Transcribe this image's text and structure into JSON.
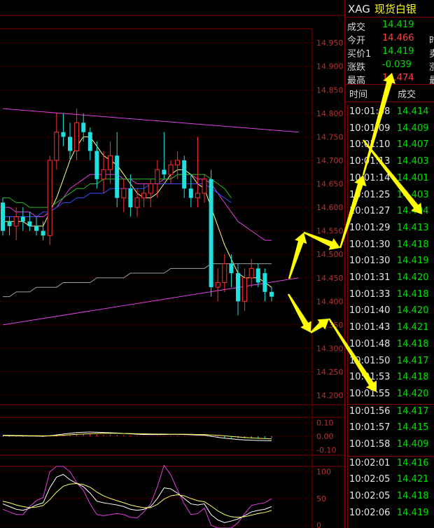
{
  "chart_data": {
    "type": "candlestick",
    "y_axis_ticks": [
      "14.950",
      "14.900",
      "14.850",
      "14.800",
      "14.750",
      "14.700",
      "14.650",
      "14.600",
      "14.550",
      "14.500",
      "14.450",
      "14.400",
      "14.350",
      "14.300",
      "14.250",
      "14.200"
    ],
    "ylim": [
      14.18,
      14.98
    ],
    "candles": [
      {
        "o": 14.61,
        "h": 14.62,
        "l": 14.54,
        "c": 14.55
      },
      {
        "o": 14.57,
        "h": 14.58,
        "l": 14.54,
        "c": 14.56
      },
      {
        "o": 14.56,
        "h": 14.6,
        "l": 14.53,
        "c": 14.58
      },
      {
        "o": 14.58,
        "h": 14.6,
        "l": 14.55,
        "c": 14.57
      },
      {
        "o": 14.57,
        "h": 14.59,
        "l": 14.55,
        "c": 14.56
      },
      {
        "o": 14.56,
        "h": 14.58,
        "l": 14.54,
        "c": 14.55
      },
      {
        "o": 14.55,
        "h": 14.57,
        "l": 14.53,
        "c": 14.54
      },
      {
        "o": 14.54,
        "h": 14.71,
        "l": 14.52,
        "c": 14.7
      },
      {
        "o": 14.7,
        "h": 14.8,
        "l": 14.68,
        "c": 14.76
      },
      {
        "o": 14.76,
        "h": 14.8,
        "l": 14.73,
        "c": 14.75
      },
      {
        "o": 14.75,
        "h": 14.78,
        "l": 14.7,
        "c": 14.72
      },
      {
        "o": 14.72,
        "h": 14.81,
        "l": 14.7,
        "c": 14.78
      },
      {
        "o": 14.78,
        "h": 14.8,
        "l": 14.74,
        "c": 14.76
      },
      {
        "o": 14.76,
        "h": 14.77,
        "l": 14.7,
        "c": 14.72
      },
      {
        "o": 14.72,
        "h": 14.74,
        "l": 14.64,
        "c": 14.66
      },
      {
        "o": 14.66,
        "h": 14.72,
        "l": 14.63,
        "c": 14.68
      },
      {
        "o": 14.68,
        "h": 14.74,
        "l": 14.65,
        "c": 14.71
      },
      {
        "o": 14.71,
        "h": 14.76,
        "l": 14.6,
        "c": 14.62
      },
      {
        "o": 14.62,
        "h": 14.66,
        "l": 14.59,
        "c": 14.64
      },
      {
        "o": 14.64,
        "h": 14.67,
        "l": 14.58,
        "c": 14.6
      },
      {
        "o": 14.6,
        "h": 14.64,
        "l": 14.58,
        "c": 14.62
      },
      {
        "o": 14.62,
        "h": 14.65,
        "l": 14.6,
        "c": 14.63
      },
      {
        "o": 14.63,
        "h": 14.66,
        "l": 14.6,
        "c": 14.65
      },
      {
        "o": 14.65,
        "h": 14.7,
        "l": 14.62,
        "c": 14.68
      },
      {
        "o": 14.68,
        "h": 14.76,
        "l": 14.66,
        "c": 14.67
      },
      {
        "o": 14.67,
        "h": 14.7,
        "l": 14.65,
        "c": 14.69
      },
      {
        "o": 14.69,
        "h": 14.72,
        "l": 14.66,
        "c": 14.7
      },
      {
        "o": 14.7,
        "h": 14.71,
        "l": 14.62,
        "c": 14.64
      },
      {
        "o": 14.64,
        "h": 14.67,
        "l": 14.6,
        "c": 14.62
      },
      {
        "o": 14.62,
        "h": 14.75,
        "l": 14.6,
        "c": 14.63
      },
      {
        "o": 14.63,
        "h": 14.67,
        "l": 14.61,
        "c": 14.66
      },
      {
        "o": 14.66,
        "h": 14.68,
        "l": 14.41,
        "c": 14.43
      },
      {
        "o": 14.43,
        "h": 14.47,
        "l": 14.4,
        "c": 14.44
      },
      {
        "o": 14.44,
        "h": 14.5,
        "l": 14.42,
        "c": 14.48
      },
      {
        "o": 14.48,
        "h": 14.5,
        "l": 14.43,
        "c": 14.46
      },
      {
        "o": 14.46,
        "h": 14.48,
        "l": 14.37,
        "c": 14.4
      },
      {
        "o": 14.4,
        "h": 14.47,
        "l": 14.38,
        "c": 14.45
      },
      {
        "o": 14.45,
        "h": 14.49,
        "l": 14.43,
        "c": 14.47
      },
      {
        "o": 14.47,
        "h": 14.48,
        "l": 14.43,
        "c": 14.44
      },
      {
        "o": 14.46,
        "h": 14.47,
        "l": 14.4,
        "c": 14.42
      },
      {
        "o": 14.42,
        "h": 14.43,
        "l": 14.4,
        "c": 14.41
      }
    ],
    "ma_lines": [
      {
        "color": "#ffff80",
        "values": [
          14.57,
          14.57,
          14.57,
          14.57,
          14.56,
          14.56,
          14.56,
          14.59,
          14.62,
          14.66,
          14.7,
          14.73,
          14.75,
          14.75,
          14.73,
          14.71,
          14.7,
          14.69,
          14.67,
          14.65,
          14.63,
          14.62,
          14.62,
          14.63,
          14.65,
          14.67,
          14.68,
          14.68,
          14.67,
          14.65,
          14.64,
          14.6,
          14.56,
          14.52,
          14.49,
          14.46,
          14.45,
          14.45,
          14.45,
          14.44,
          14.43
        ]
      },
      {
        "color": "#e040e0",
        "values": [
          14.6,
          14.6,
          14.59,
          14.59,
          14.59,
          14.58,
          14.58,
          14.59,
          14.6,
          14.62,
          14.64,
          14.65,
          14.66,
          14.67,
          14.67,
          14.67,
          14.67,
          14.67,
          14.66,
          14.66,
          14.65,
          14.65,
          14.65,
          14.65,
          14.66,
          14.66,
          14.67,
          14.67,
          14.67,
          14.66,
          14.66,
          14.65,
          14.63,
          14.61,
          14.59,
          14.57,
          14.56,
          14.55,
          14.54,
          14.53,
          14.53
        ]
      },
      {
        "color": "#20c020",
        "values": [
          14.62,
          14.62,
          14.61,
          14.61,
          14.6,
          14.6,
          14.6,
          14.6,
          14.61,
          14.62,
          14.63,
          14.64,
          14.64,
          14.65,
          14.65,
          14.66,
          14.66,
          14.66,
          14.66,
          14.66,
          14.66,
          14.66,
          14.66,
          14.66,
          14.66,
          14.66,
          14.67,
          14.67,
          14.67,
          14.67,
          14.67,
          14.66,
          14.65,
          14.64,
          14.62
        ]
      },
      {
        "color": "#3050ff",
        "values": [
          14.58,
          14.58,
          14.58,
          14.58,
          14.58,
          14.58,
          14.59,
          14.59,
          14.6,
          14.61,
          14.61,
          14.62,
          14.62,
          14.63,
          14.63,
          14.63,
          14.64,
          14.64,
          14.64,
          14.64,
          14.64,
          14.64,
          14.65,
          14.65,
          14.65,
          14.65,
          14.65,
          14.65,
          14.65,
          14.65,
          14.65,
          14.64,
          14.63,
          14.62,
          14.61
        ]
      },
      {
        "color": "#a0a0a0",
        "values": [
          14.41,
          14.41,
          14.42,
          14.42,
          14.42,
          14.43,
          14.43,
          14.43,
          14.43,
          14.44,
          14.44,
          14.44,
          14.44,
          14.44,
          14.45,
          14.45,
          14.45,
          14.45,
          14.45,
          14.46,
          14.46,
          14.46,
          14.46,
          14.46,
          14.46,
          14.47,
          14.47,
          14.47,
          14.47,
          14.47,
          14.47,
          14.48,
          14.48,
          14.48,
          14.48,
          14.48,
          14.48,
          14.48,
          14.48,
          14.48,
          14.48
        ]
      }
    ],
    "trend_lines": [
      {
        "color": "#e040e0",
        "from": [
          0,
          14.81
        ],
        "to": [
          44,
          14.76
        ]
      },
      {
        "color": "#e040e0",
        "from": [
          0,
          14.35
        ],
        "to": [
          44,
          14.45
        ]
      }
    ],
    "macd_panel": {
      "ticks": [
        "0.10",
        "0.00",
        "-0.10"
      ],
      "ylim": [
        -0.14,
        0.14
      ],
      "hist": [
        -0.005,
        -0.004,
        -0.003,
        -0.003,
        -0.002,
        -0.003,
        -0.004,
        0.003,
        0.008,
        0.012,
        0.015,
        0.017,
        0.018,
        0.017,
        0.014,
        0.012,
        0.012,
        0.011,
        0.008,
        0.006,
        0.003,
        0.002,
        0.001,
        0.002,
        0.004,
        0.005,
        0.006,
        0.004,
        0.002,
        0.001,
        0.0,
        -0.006,
        -0.01,
        -0.012,
        -0.013,
        -0.015,
        -0.015,
        -0.014,
        -0.014,
        -0.013,
        -0.013
      ],
      "line1": [
        0.005,
        0.004,
        0.003,
        0.002,
        0.002,
        0.001,
        0.0,
        0.004,
        0.01,
        0.016,
        0.022,
        0.027,
        0.03,
        0.031,
        0.03,
        0.028,
        0.026,
        0.024,
        0.021,
        0.018,
        0.015,
        0.013,
        0.012,
        0.012,
        0.013,
        0.014,
        0.014,
        0.013,
        0.011,
        0.009,
        0.008,
        0.0,
        -0.008,
        -0.014,
        -0.019,
        -0.024,
        -0.027,
        -0.029,
        -0.031,
        -0.032,
        -0.033
      ],
      "line2": [
        0.008,
        0.007,
        0.006,
        0.005,
        0.004,
        0.004,
        0.003,
        0.003,
        0.005,
        0.008,
        0.011,
        0.014,
        0.017,
        0.019,
        0.021,
        0.022,
        0.022,
        0.022,
        0.021,
        0.02,
        0.019,
        0.018,
        0.017,
        0.016,
        0.016,
        0.015,
        0.015,
        0.015,
        0.014,
        0.013,
        0.012,
        0.01,
        0.007,
        0.003,
        -0.001,
        -0.005,
        -0.009,
        -0.012,
        -0.015,
        -0.017,
        -0.02
      ]
    },
    "kdj_panel": {
      "ticks": [
        "100",
        "50",
        "0"
      ],
      "ylim": [
        -5,
        110
      ],
      "k": [
        40,
        35,
        30,
        28,
        32,
        38,
        42,
        70,
        90,
        95,
        85,
        78,
        72,
        60,
        45,
        42,
        40,
        38,
        35,
        30,
        28,
        30,
        35,
        50,
        70,
        68,
        60,
        50,
        40,
        38,
        40,
        20,
        10,
        5,
        8,
        12,
        18,
        25,
        28,
        30,
        35
      ],
      "d": [
        45,
        42,
        38,
        35,
        33,
        34,
        37,
        48,
        62,
        73,
        77,
        78,
        76,
        71,
        62,
        55,
        50,
        46,
        42,
        38,
        35,
        33,
        33,
        39,
        49,
        55,
        57,
        55,
        50,
        46,
        44,
        36,
        27,
        20,
        16,
        15,
        16,
        19,
        22,
        24,
        28
      ],
      "j": [
        30,
        25,
        20,
        20,
        35,
        46,
        52,
        100,
        110,
        110,
        100,
        80,
        65,
        40,
        20,
        18,
        20,
        22,
        20,
        15,
        14,
        25,
        40,
        72,
        112,
        94,
        66,
        40,
        20,
        22,
        32,
        0,
        -5,
        -5,
        -5,
        5,
        22,
        37,
        40,
        42,
        50
      ]
    },
    "annotations": [
      "yellow arrows marking a zigzag price path"
    ]
  },
  "panel": {
    "symbol": "XAG",
    "name": "现货白银",
    "quote_rows": [
      {
        "label": "成交",
        "value": "14.419",
        "color": "#00e000",
        "trail": ""
      },
      {
        "label": "今开",
        "value": "14.466",
        "color": "#ff4040",
        "trail": "时"
      },
      {
        "label": "买价1",
        "value": "14.419",
        "color": "#00e000",
        "trail": "卖"
      },
      {
        "label": "涨跌",
        "value": "-0.039",
        "color": "#00e000",
        "trail": "涨"
      },
      {
        "label": "最高",
        "value": "14.474",
        "color": "#ff4040",
        "trail": "最"
      }
    ],
    "header_time": "时间",
    "header_trade": "成交",
    "ticks": [
      {
        "time": "10:01:08",
        "price": "14.414"
      },
      {
        "time": "10:01:09",
        "price": "14.409"
      },
      {
        "time": "10:01:10",
        "price": "14.407"
      },
      {
        "time": "10:01:13",
        "price": "14.403"
      },
      {
        "time": "10:01:14",
        "price": "14.401"
      },
      {
        "time": "10:01:25",
        "price": "14.403"
      },
      {
        "time": "10:01:27",
        "price": "14.404"
      },
      {
        "time": "10:01:29",
        "price": "14.413"
      },
      {
        "time": "10:01:30",
        "price": "14.418"
      },
      {
        "time": "10:01:30",
        "price": "14.419"
      },
      {
        "time": "10:01:31",
        "price": "14.420"
      },
      {
        "time": "10:01:33",
        "price": "14.418"
      },
      {
        "time": "10:01:40",
        "price": "14.420"
      },
      {
        "time": "10:01:43",
        "price": "14.421"
      },
      {
        "time": "10:01:48",
        "price": "14.418"
      },
      {
        "time": "10:01:50",
        "price": "14.417"
      },
      {
        "time": "10:01:53",
        "price": "14.418"
      },
      {
        "time": "10:01:55",
        "price": "14.420"
      },
      {
        "time": "10:01:56",
        "price": "14.417"
      },
      {
        "time": "10:01:57",
        "price": "14.415"
      },
      {
        "time": "10:01:58",
        "price": "14.409"
      },
      {
        "time": "10:02:01",
        "price": "14.416"
      },
      {
        "time": "10:02:05",
        "price": "14.421"
      },
      {
        "time": "10:02:05",
        "price": "14.418"
      },
      {
        "time": "10:02:06",
        "price": "14.419"
      }
    ],
    "tick_color": "#00e000"
  }
}
